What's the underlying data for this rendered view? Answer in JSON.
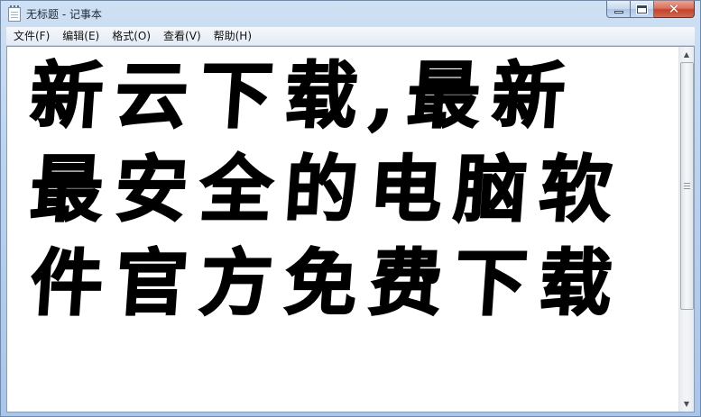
{
  "window": {
    "title": "无标题 - 记事本"
  },
  "caption": {
    "close_glyph": "✕"
  },
  "menu": {
    "items": [
      {
        "label": "文件(F)"
      },
      {
        "label": "编辑(E)"
      },
      {
        "label": "格式(O)"
      },
      {
        "label": "查看(V)"
      },
      {
        "label": "帮助(H)"
      }
    ]
  },
  "editor": {
    "lines": [
      "新云下载,最新",
      "最安全的电脑软",
      "件官方免费下载"
    ]
  },
  "scrollbar": {
    "up_arrow": "▲",
    "down_arrow": "▼"
  },
  "icons": [
    "notepad-icon",
    "minimize-icon",
    "maximize-icon",
    "close-icon",
    "scroll-up-arrow-icon",
    "scroll-down-arrow-icon",
    "scroll-grip-icon"
  ],
  "colors": {
    "close_button": "#c2442b",
    "text": "#000000",
    "background": "#ffffff"
  }
}
